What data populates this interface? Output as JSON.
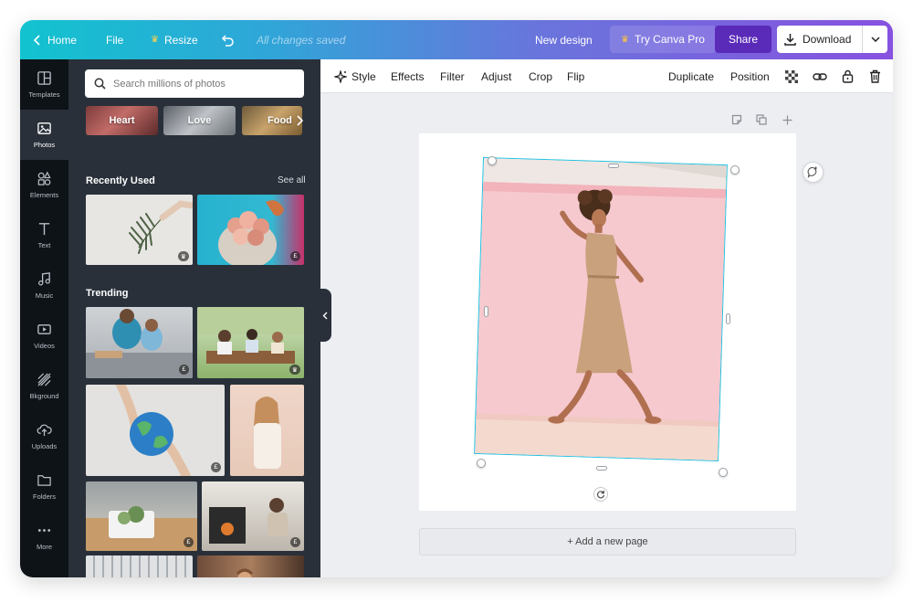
{
  "topbar": {
    "home": "Home",
    "file": "File",
    "resize": "Resize",
    "saved": "All changes saved",
    "new_design": "New design",
    "try_pro": "Try Canva Pro",
    "share": "Share",
    "download": "Download"
  },
  "rail": [
    {
      "label": "Templates",
      "icon": "templates-icon"
    },
    {
      "label": "Photos",
      "icon": "photos-icon",
      "active": true
    },
    {
      "label": "Elements",
      "icon": "elements-icon"
    },
    {
      "label": "Text",
      "icon": "text-icon"
    },
    {
      "label": "Music",
      "icon": "music-icon"
    },
    {
      "label": "Videos",
      "icon": "videos-icon"
    },
    {
      "label": "Bkground",
      "icon": "background-icon"
    },
    {
      "label": "Uploads",
      "icon": "uploads-icon"
    },
    {
      "label": "Folders",
      "icon": "folders-icon"
    },
    {
      "label": "More",
      "icon": "more-icon"
    }
  ],
  "panel": {
    "search_placeholder": "Search millions of photos",
    "chips": [
      "Heart",
      "Love",
      "Food"
    ],
    "recently_used": "Recently Used",
    "see_all": "See all",
    "trending": "Trending",
    "badges": {
      "crown": "♛",
      "pound": "£"
    }
  },
  "toolbar": {
    "style": "Style",
    "effects": "Effects",
    "filter": "Filter",
    "adjust": "Adjust",
    "crop": "Crop",
    "flip": "Flip",
    "duplicate": "Duplicate",
    "position": "Position"
  },
  "canvas": {
    "add_page": "+ Add a new page",
    "selection_color": "#1ec2e0"
  },
  "colors": {
    "gradient_start": "#12c3cf",
    "gradient_end": "#8752e0",
    "share_button": "#5a2ab8",
    "panel": "#293039",
    "rail": "#0e1318"
  }
}
